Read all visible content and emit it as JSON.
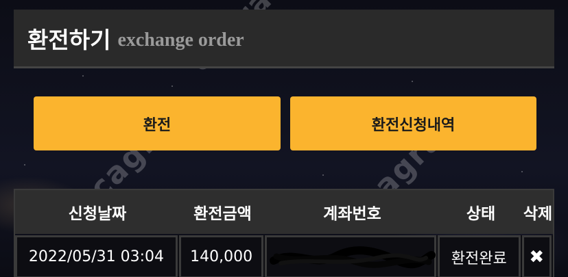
{
  "header": {
    "title": "환전하기",
    "subtitle": "exchange order"
  },
  "buttons": {
    "exchange": "환전",
    "history": "환전신청내역"
  },
  "table": {
    "columns": [
      "신청날짜",
      "환전금액",
      "계좌번호",
      "상태",
      "삭제"
    ],
    "rows": [
      {
        "date": "2022/05/31 03:04",
        "amount": "140,000",
        "account": "",
        "status": "환전완료",
        "delete": "✖"
      }
    ]
  },
  "watermark": "cagram",
  "colors": {
    "accent": "#fbb42e",
    "header_bg": "#2a2a2a",
    "table_header_bg": "#2e2e2e"
  }
}
